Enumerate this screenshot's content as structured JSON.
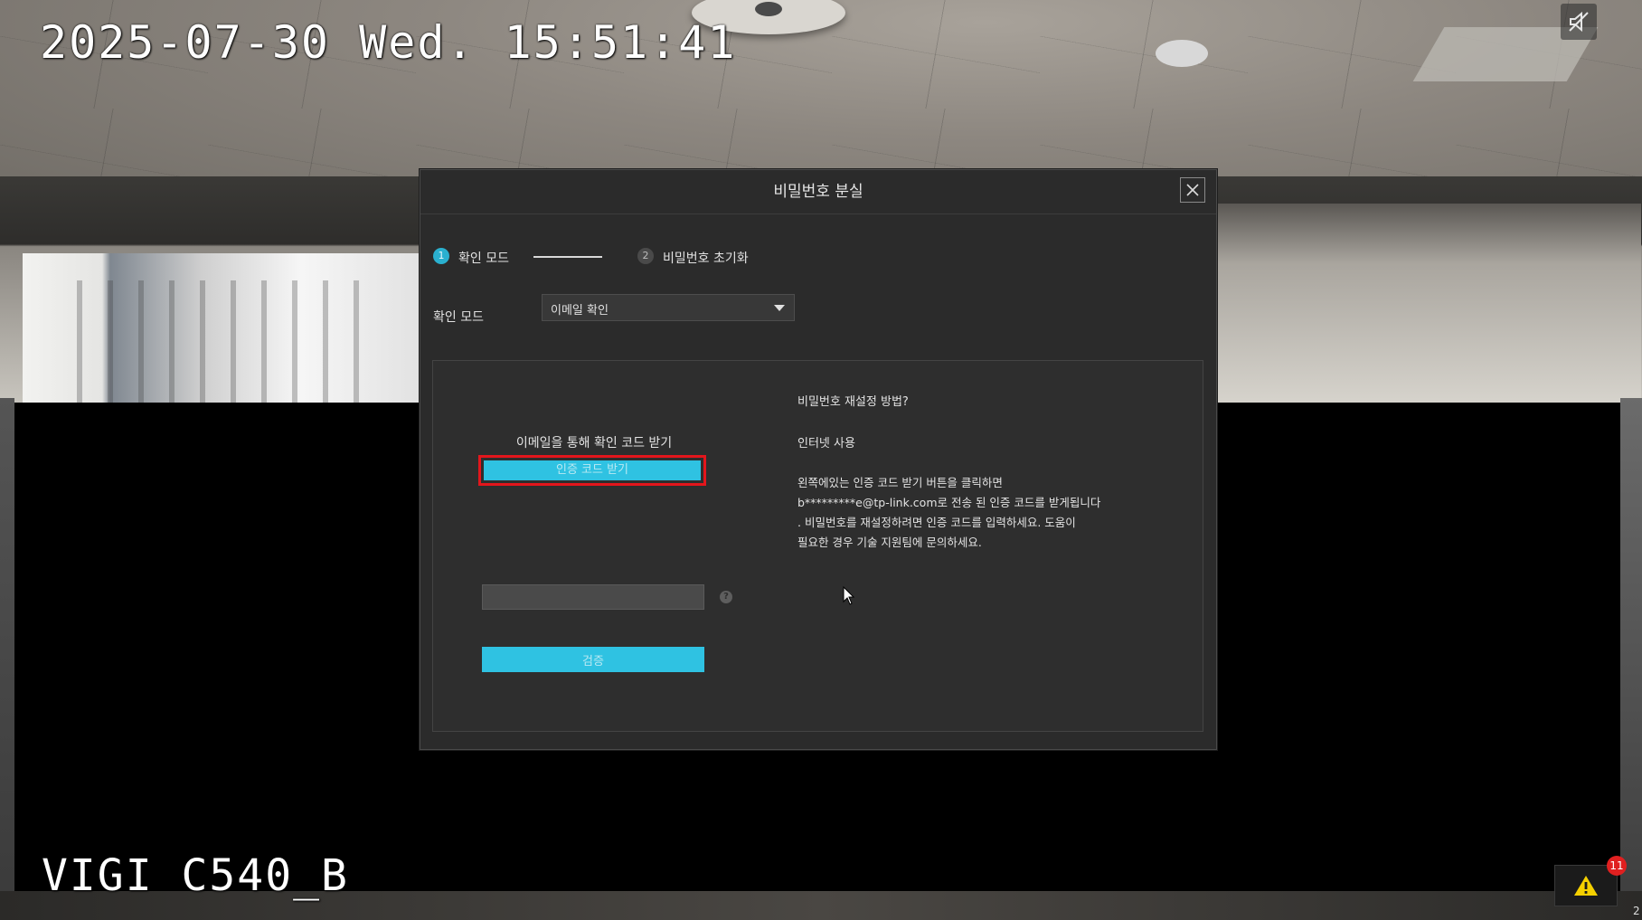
{
  "osd": {
    "timestamp": "2025-07-30 Wed. 15:51:41",
    "camera_name": "VIGI C540_B"
  },
  "icons": {
    "mute": "speaker-muted-icon",
    "alarm": "warning-triangle-icon",
    "close": "close-icon",
    "dropdown": "chevron-down-icon",
    "help": "question-icon"
  },
  "alarm": {
    "count": "11"
  },
  "corner_label": "2",
  "dialog": {
    "title": "비밀번호 분실",
    "steps": [
      {
        "number": "1",
        "label": "확인 모드",
        "active": true
      },
      {
        "number": "2",
        "label": "비밀번호 초기화",
        "active": false
      }
    ],
    "mode_label": "확인 모드",
    "mode_value": "이메일 확인",
    "left": {
      "caption": "이메일을 통해 확인 코드 받기",
      "get_code_button": "인증 코드 받기",
      "code_input_value": "",
      "verify_button": "검증"
    },
    "right": {
      "title": "비밀번호 재설정 방법?",
      "subtitle": "인터넷 사용",
      "lines": [
        "왼쪽에있는 인증 코드 받기 버튼을 클릭하면",
        "b*********e@tp-link.com로 전송 된 인증 코드를 받게됩니다",
        ". 비밀번호를 재설정하려면 인증 코드를 입력하세요. 도움이",
        " 필요한 경우 기술 지원팀에 문의하세요."
      ]
    }
  },
  "colors": {
    "accent": "#2fc2e2",
    "highlight": "#e3161c",
    "dialog_bg": "#2b2b2b",
    "badge": "#e02020"
  }
}
